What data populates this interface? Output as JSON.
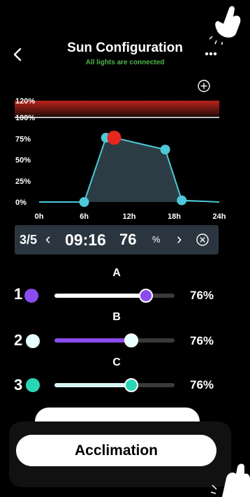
{
  "header": {
    "title": "Sun Configuration",
    "subtitle": "All lights are connected"
  },
  "chart_data": {
    "type": "area",
    "x_ticks": [
      "0h",
      "6h",
      "12h",
      "18h",
      "24h"
    ],
    "y_ticks": [
      "0%",
      "25%",
      "50%",
      "75%",
      "100%",
      "120%"
    ],
    "xlim": [
      0,
      24
    ],
    "ylim": [
      0,
      120
    ],
    "points": [
      {
        "x": 0,
        "y": 0
      },
      {
        "x": 6,
        "y": 0
      },
      {
        "x": 8.9,
        "y": 76
      },
      {
        "x": 10,
        "y": 76
      },
      {
        "x": 16.8,
        "y": 62
      },
      {
        "x": 19,
        "y": 2
      },
      {
        "x": 24,
        "y": 0
      }
    ],
    "marker_points": [
      {
        "x": 6,
        "y": 0
      },
      {
        "x": 8.9,
        "y": 76
      },
      {
        "x": 16.8,
        "y": 62
      },
      {
        "x": 19,
        "y": 2
      }
    ],
    "selected_point": {
      "x": 10,
      "y": 76
    },
    "over_range": [
      100,
      120
    ],
    "colors": {
      "line": "#4dc8d8",
      "fill": "#2c3c45",
      "selected": "#e8271e",
      "band_top": "#b9231c",
      "band_bottom": "#2a0d08"
    }
  },
  "control": {
    "position": "3/5",
    "prev_glyph": "‹",
    "time": "09:16",
    "value": "76",
    "unit": "%",
    "next_glyph": "›"
  },
  "channels": [
    {
      "label": "A",
      "number": "1",
      "value": 76,
      "value_text": "76%",
      "color": "#8a4cf0",
      "track_fill": "#ffffff"
    },
    {
      "label": "B",
      "number": "2",
      "value": 64,
      "value_text": "76%",
      "color": "#e6ffff",
      "track_fill": "#8a4cf0"
    },
    {
      "label": "C",
      "number": "3",
      "value": 64,
      "value_text": "76%",
      "color": "#2ad5b6",
      "track_fill": "#d8f6f6"
    }
  ],
  "buttons": {
    "acclimation": "Acclimation"
  }
}
